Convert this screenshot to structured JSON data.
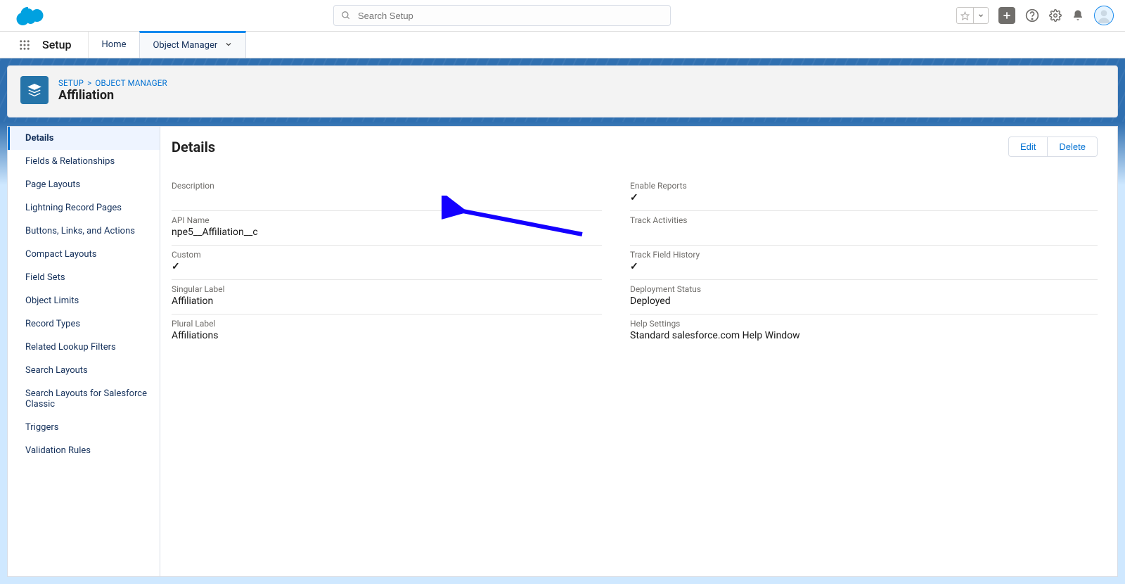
{
  "header": {
    "search_placeholder": "Search Setup"
  },
  "context": {
    "app_title": "Setup",
    "tabs": [
      {
        "label": "Home",
        "active": false,
        "has_menu": false
      },
      {
        "label": "Object Manager",
        "active": true,
        "has_menu": true
      }
    ]
  },
  "breadcrumb": {
    "a": "SETUP",
    "b": "OBJECT MANAGER"
  },
  "page_title": "Affiliation",
  "sidebar": {
    "items": [
      "Details",
      "Fields & Relationships",
      "Page Layouts",
      "Lightning Record Pages",
      "Buttons, Links, and Actions",
      "Compact Layouts",
      "Field Sets",
      "Object Limits",
      "Record Types",
      "Related Lookup Filters",
      "Search Layouts",
      "Search Layouts for Salesforce Classic",
      "Triggers",
      "Validation Rules"
    ],
    "active_index": 0
  },
  "details": {
    "heading": "Details",
    "buttons": {
      "edit": "Edit",
      "delete": "Delete"
    },
    "left_fields": [
      {
        "label": "Description",
        "value": ""
      },
      {
        "label": "API Name",
        "value": "npe5__Affiliation__c"
      },
      {
        "label": "Custom",
        "value": "✓"
      },
      {
        "label": "Singular Label",
        "value": "Affiliation"
      },
      {
        "label": "Plural Label",
        "value": "Affiliations"
      }
    ],
    "right_fields": [
      {
        "label": "Enable Reports",
        "value": "✓"
      },
      {
        "label": "Track Activities",
        "value": ""
      },
      {
        "label": "Track Field History",
        "value": "✓"
      },
      {
        "label": "Deployment Status",
        "value": "Deployed"
      },
      {
        "label": "Help Settings",
        "value": "Standard salesforce.com Help Window"
      }
    ]
  }
}
